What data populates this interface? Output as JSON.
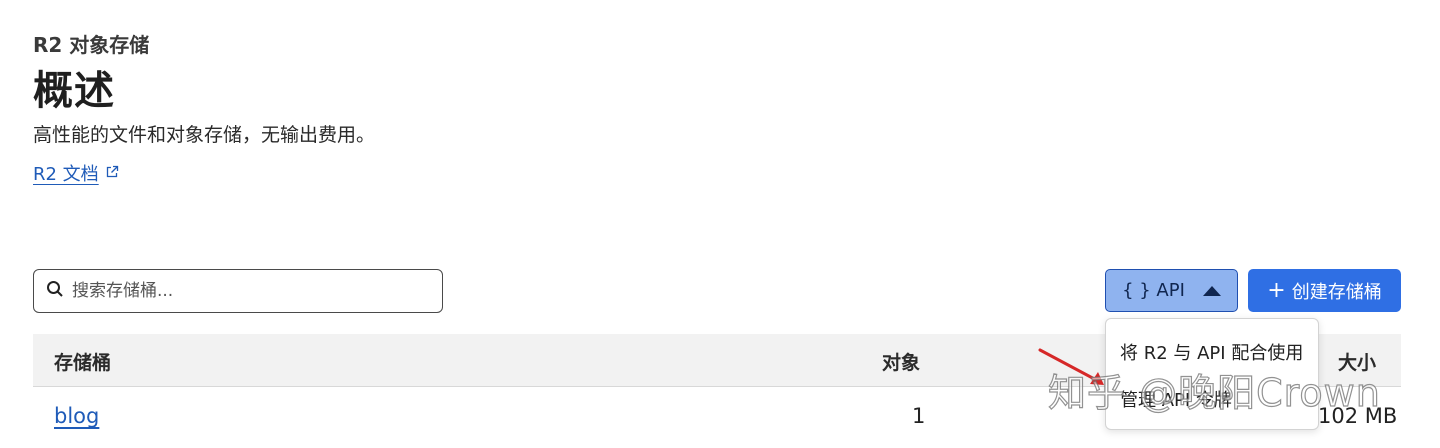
{
  "header": {
    "eyebrow": "R2 对象存储",
    "title": "概述",
    "subtitle": "高性能的文件和对象存储，无输出费用。",
    "docs_link": "R2 文档",
    "docs_icon": "external-link-icon"
  },
  "toolbar": {
    "search_placeholder": "搜索存储桶...",
    "search_icon": "search-icon",
    "api_label": "{ } API",
    "create_label": "创建存储桶"
  },
  "table": {
    "columns": [
      "存储桶",
      "对象",
      "大小"
    ],
    "rows": [
      {
        "name": "blog",
        "objects": "1",
        "size": "102 MB"
      }
    ]
  },
  "api_menu": {
    "items": [
      "将 R2 与 API 配合使用",
      "管理 API 令牌"
    ]
  },
  "watermark": "知乎 @晚阳Crown",
  "colors": {
    "link": "#1f5bb8",
    "primary": "#2f6fe4",
    "api_button_bg": "#8fb3ef",
    "arrow": "#d62828"
  }
}
